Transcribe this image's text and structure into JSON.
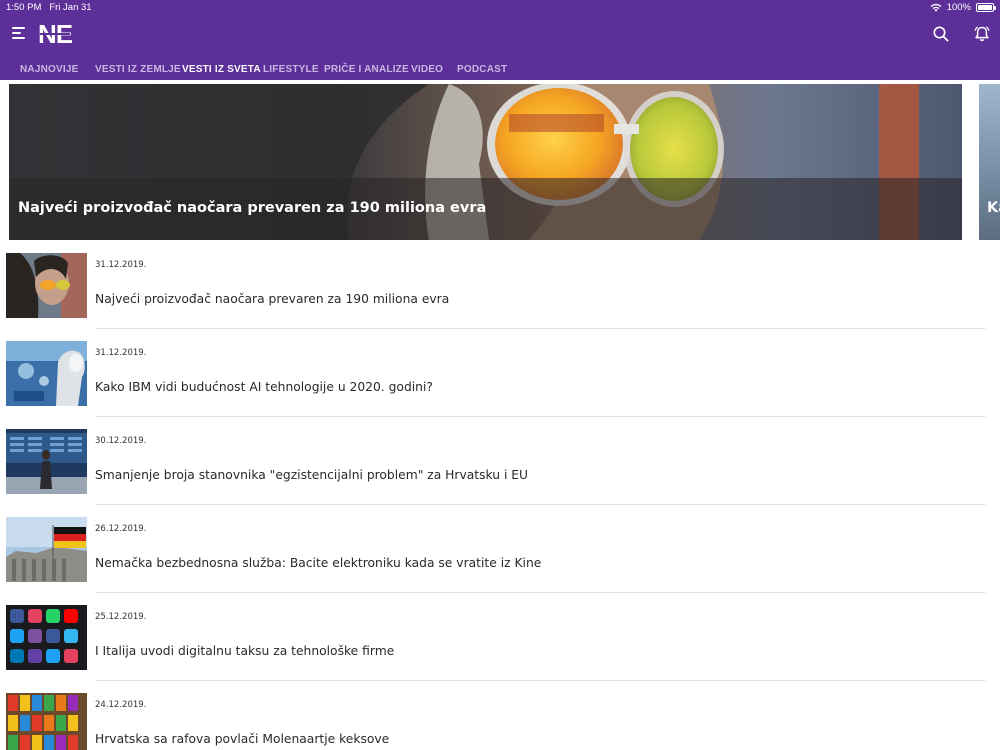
{
  "status_bar": {
    "time": "1:50 PM",
    "date": "Fri Jan 31",
    "battery": "100%",
    "battery_level": 1.0
  },
  "header": {
    "logo_text": "NE",
    "background": "#5d2f98"
  },
  "tabs": [
    {
      "label": "NAJNOVIJE",
      "active": false
    },
    {
      "label": "VESTI IZ ZEMLJE",
      "active": false
    },
    {
      "label": "VESTI IZ SVETA",
      "active": true
    },
    {
      "label": "LIFESTYLE",
      "active": false
    },
    {
      "label": "PRIČE I ANALIZE",
      "active": false
    },
    {
      "label": "VIDEO",
      "active": false
    },
    {
      "label": "PODCAST",
      "active": false
    }
  ],
  "hero": {
    "title": "Najveći proizvođač naočara prevaren za 190 miliona evra",
    "next_peek": "Ka"
  },
  "articles": [
    {
      "date": "31.12.2019.",
      "title": "Najveći proizvođač naočara prevaren za 190 miliona evra"
    },
    {
      "date": "31.12.2019.",
      "title": "Kako IBM vidi budućnost AI tehnologije u 2020. godini?"
    },
    {
      "date": "30.12.2019.",
      "title": "Smanjenje broja stanovnika \"egzistencijalni problem\" za Hrvatsku i EU"
    },
    {
      "date": "26.12.2019.",
      "title": "Nemačka bezbednosna služba: Bacite elektroniku kada se vratite iz Kine"
    },
    {
      "date": "25.12.2019.",
      "title": "I Italija uvodi digitalnu taksu za tehnološke firme"
    },
    {
      "date": "24.12.2019.",
      "title": "Hrvatska sa rafova povlači Molenaartje keksove"
    }
  ]
}
